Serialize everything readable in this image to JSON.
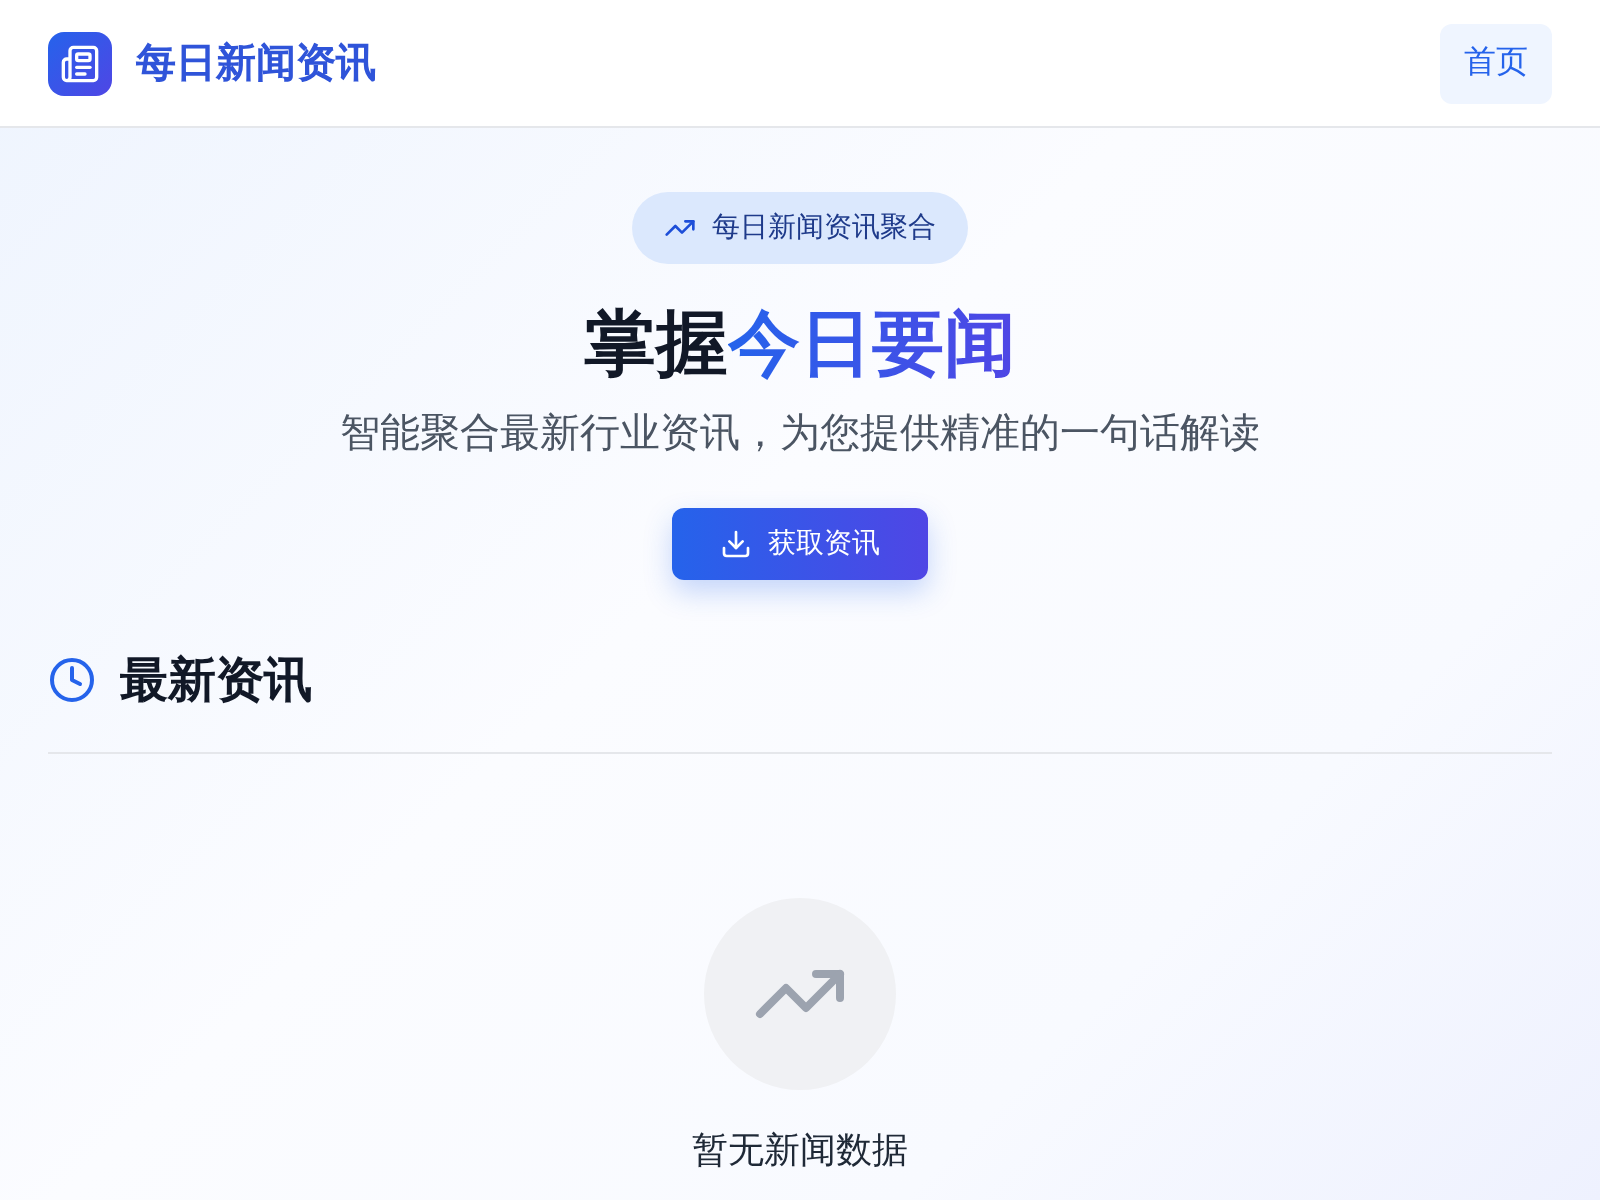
{
  "header": {
    "brand": "每日新闻资讯",
    "nav": [
      {
        "label": "首页",
        "selected": true
      }
    ]
  },
  "hero": {
    "badge": "每日新闻资讯聚合",
    "title": "掌握",
    "title_highlight": "今日要闻",
    "subtitle": "智能聚合最新行业资讯，为您提供精准的一句话解读",
    "button": "获取资讯"
  },
  "section": {
    "title": "最新资讯",
    "empty_text": "暂无新闻数据"
  }
}
